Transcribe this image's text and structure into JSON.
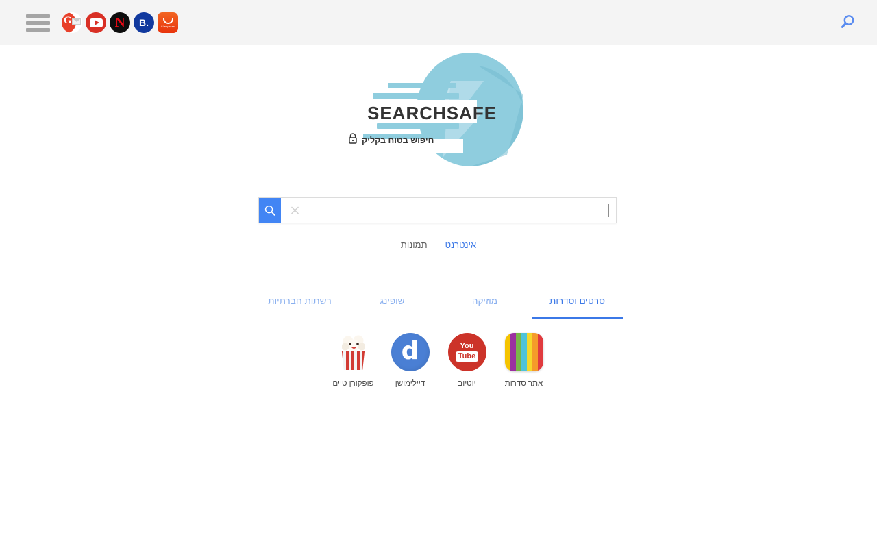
{
  "browser_bar": {
    "menu": {
      "name": "hamburger-menu",
      "label": ""
    },
    "favorites": [
      {
        "id": "gmail",
        "label": "G",
        "title": "Gmail"
      },
      {
        "id": "youtube",
        "label": "",
        "title": "YouTube"
      },
      {
        "id": "netflix",
        "label": "N",
        "title": "Netflix"
      },
      {
        "id": "booking",
        "label": "B.",
        "title": "Booking.com"
      },
      {
        "id": "aliexpress",
        "label": "Aliexpress",
        "title": "AliExpress"
      }
    ],
    "search_icon": "search-icon"
  },
  "logo": {
    "wordmark": "SEARCHSAFE",
    "tagline": "חיפוש בטוח בקליק",
    "lock_icon": "lock-icon",
    "colors": {
      "circle": "#8fcdde",
      "circle_shade": "#74bcd0",
      "bolt": "#b9e0ea",
      "bolt_shade": "#a5d6e4",
      "text": "#333333"
    }
  },
  "search": {
    "value": "",
    "placeholder": "",
    "search_button_icon": "search-icon",
    "clear_button_icon": "close-icon",
    "button_color": "#4285f4"
  },
  "mode_tabs": [
    {
      "label": "אינטרנט",
      "active": true
    },
    {
      "label": "תמונות",
      "active": false
    }
  ],
  "category_tabs": [
    {
      "label": "רשתות חברתיות",
      "active": false
    },
    {
      "label": "שופינג",
      "active": false
    },
    {
      "label": "מוזיקה",
      "active": false
    },
    {
      "label": "סרטים וסדרות",
      "active": true
    }
  ],
  "shortcuts": [
    {
      "label": "אתר סדרות",
      "icon": "series-stripes-icon"
    },
    {
      "label": "יוטיוב",
      "icon": "youtube-icon",
      "word_top": "You",
      "word_bottom": "Tube"
    },
    {
      "label": "דיילימושן",
      "icon": "dailymotion-icon",
      "letter": "d"
    },
    {
      "label": "פופקורן טיים",
      "icon": "popcorn-time-icon"
    }
  ],
  "theme": {
    "bar_background": "#f4f4f4",
    "page_background": "#ffffff",
    "accent_blue": "#3b78e7",
    "muted_blue": "#8ab0ef",
    "text_gray": "#4f4f4f"
  }
}
